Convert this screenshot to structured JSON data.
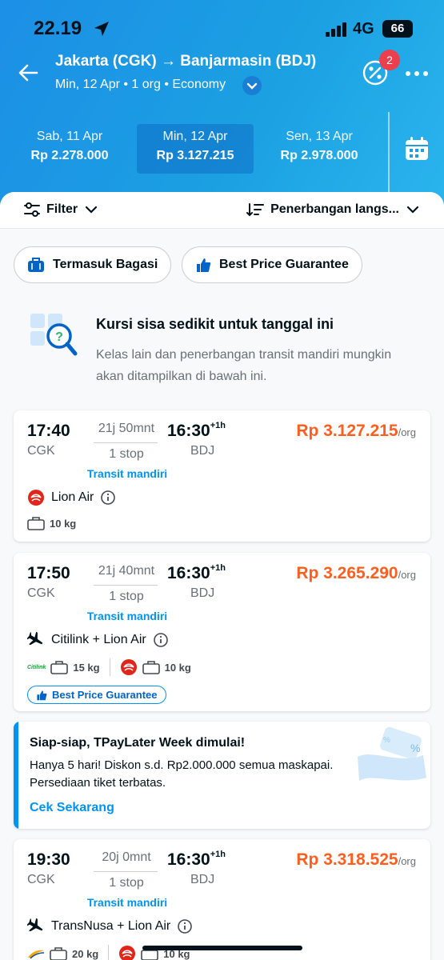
{
  "status": {
    "time": "22.19",
    "network": "4G",
    "battery": "66"
  },
  "header": {
    "route": "Jakarta (CGK) → Banjarmasin (BDJ)",
    "subtitle": "Min, 12 Apr • 1 org • Economy",
    "promo_badge_count": "2"
  },
  "dates": [
    {
      "day": "Sab, 11 Apr",
      "price": "Rp 2.278.000"
    },
    {
      "day": "Min, 12 Apr",
      "price": "Rp 3.127.215"
    },
    {
      "day": "Sen, 13 Apr",
      "price": "Rp 2.978.000"
    }
  ],
  "filterbar": {
    "filter_label": "Filter",
    "sort_label": "Penerbangan langs..."
  },
  "chips": {
    "baggage": "Termasuk Bagasi",
    "bpg": "Best Price Guarantee"
  },
  "info": {
    "title": "Kursi sisa sedikit untuk tanggal ini",
    "desc": "Kelas lain dan penerbangan transit mandiri mungkin akan ditampilkan di bawah ini."
  },
  "flights": [
    {
      "dep": "17:40",
      "dep_code": "CGK",
      "duration": "21j 50mnt",
      "stops": "1 stop",
      "transit": "Transit mandiri",
      "arr": "16:30",
      "arr_offset": "+1h",
      "arr_code": "BDJ",
      "price": "Rp 3.127.215",
      "per": "/org",
      "airline": "Lion Air",
      "bag1": "10 kg"
    },
    {
      "dep": "17:50",
      "dep_code": "CGK",
      "duration": "21j 40mnt",
      "stops": "1 stop",
      "transit": "Transit mandiri",
      "arr": "16:30",
      "arr_offset": "+1h",
      "arr_code": "BDJ",
      "price": "Rp 3.265.290",
      "per": "/org",
      "airline": "Citilink + Lion Air",
      "bag1_brand": "Citilink",
      "bag1": "15 kg",
      "bag2": "10 kg",
      "badge": "Best Price Guarantee"
    },
    {
      "dep": "19:30",
      "dep_code": "CGK",
      "duration": "20j 0mnt",
      "stops": "1 stop",
      "transit": "Transit mandiri",
      "arr": "16:30",
      "arr_offset": "+1h",
      "arr_code": "BDJ",
      "price": "Rp 3.318.525",
      "per": "/org",
      "airline": "TransNusa + Lion Air",
      "bag1": "20 kg",
      "bag2": "10 kg"
    }
  ],
  "promo": {
    "title": "Siap-siap, TPayLater Week dimulai!",
    "desc": "Hanya 5 hari! Diskon s.d. Rp2.000.000 semua maskapai. Persediaan tiket terbatas.",
    "link": "Cek Sekarang"
  },
  "colors": {
    "brand_blue": "#0194f3",
    "price_orange": "#ff5e1f",
    "header_start": "#1c8fe6"
  }
}
